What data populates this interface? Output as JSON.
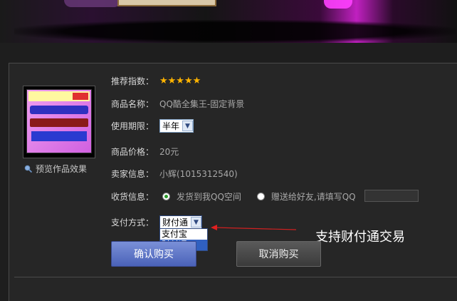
{
  "rating": {
    "label": "推荐指数：",
    "stars": "★★★★★"
  },
  "product_name": {
    "label": "商品名称：",
    "value": "QQ酷全集王-固定背景"
  },
  "duration": {
    "label": "使用期限：",
    "selected": "半年"
  },
  "price": {
    "label": "商品价格：",
    "value": "20元"
  },
  "seller": {
    "label": "卖家信息：",
    "value": "小辉(1015312540)"
  },
  "delivery": {
    "label": "收货信息：",
    "option1": "发货到我QQ空间",
    "option2": "赠送给好友,请填写QQ",
    "selected": "option1"
  },
  "payment": {
    "label": "支付方式：",
    "selected": "财付通",
    "options": [
      "支付宝",
      "财付通"
    ]
  },
  "preview_label": "预览作品效果",
  "buttons": {
    "confirm": "确认购买",
    "cancel": "取消购买"
  },
  "annotation": "支持财付通交易",
  "colors": {
    "stars": "#ffb400",
    "confirm": "#5a72c8",
    "annotation_arrow": "#d02020"
  }
}
